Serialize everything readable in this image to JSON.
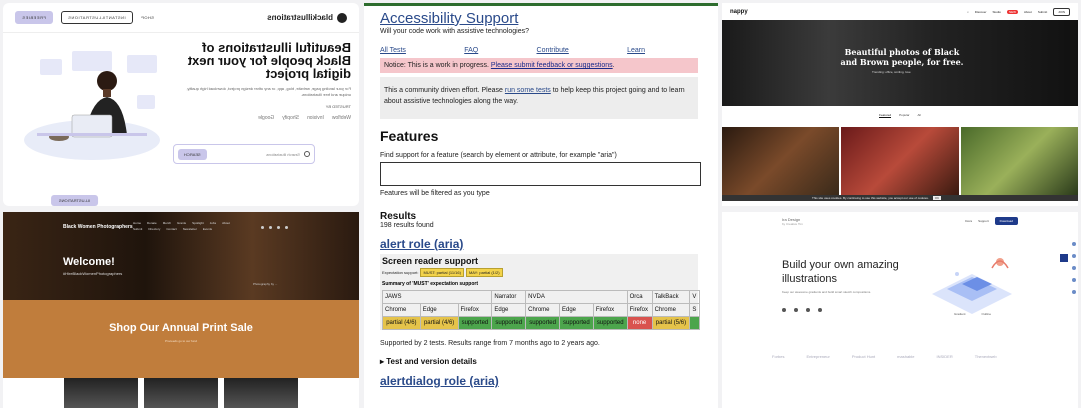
{
  "tile1": {
    "brand": "blackillustrations",
    "nav": [
      "FREEBIES",
      "INSTANTILLUSTRATIONS",
      "SHOP"
    ],
    "headline": "Beautiful illustrations of Black people for your next digital project",
    "body": "For your landing page, website, blog, app, or any other design project, download high quality, unique and free illustrations.",
    "trusted": "TRUSTED BY",
    "brands": [
      "Webflow",
      "Invision",
      "Shopify",
      "Google"
    ],
    "search_placeholder": "Search illustrations",
    "search_button": "SEARCH",
    "badge": "ILLUSTRATIONS",
    "accent": "#c9c6ea"
  },
  "tile2": {
    "brand": "Black Women Photographers",
    "menu": [
      "Home",
      "Donate",
      "Merch",
      "Grants",
      "Spotlight",
      "Jobs",
      "About",
      "Submit",
      "Directory",
      "Contact",
      "Newsletter",
      "Events"
    ],
    "headline": "Welcome!",
    "tagline": "#HireBlackWomenPhotographers",
    "credit": "Photography by ...",
    "sale_title": "Shop Our Annual Print Sale",
    "sale_sub": "Proceeds go to our fund",
    "sale_color": "#c07d3c"
  },
  "tile3": {
    "title": "Accessibility Support",
    "subtitle": "Will your code work with assistive technologies?",
    "nav": [
      "All Tests",
      "FAQ",
      "Contribute",
      "Learn"
    ],
    "notice_prefix": "Notice: This is a work in progress. ",
    "notice_link": "Please submit feedback or suggestions",
    "notice_suffix": ".",
    "community_pre": "This a community driven effort. Please ",
    "community_link": "run some tests",
    "community_post": " to help keep this project going and to learn about assistive technologies along the way.",
    "features_heading": "Features",
    "find_label": "Find support for a feature (search by element or attribute, for example \"aria\")",
    "filter_note": "Features will be filtered as you type",
    "results_heading": "Results",
    "results_count": "198 results found",
    "card_title": "alert role (aria)",
    "sr_heading": "Screen reader support",
    "expectation_label": "Expectation support:",
    "expectation_must": "MUST: partial (11/16)",
    "expectation_may": "MAY: partial (1/2)",
    "summary_label": "Summary of 'MUST' expectation support",
    "table": {
      "row1": [
        "JAWS",
        "",
        "Narrator",
        "NVDA",
        "",
        "Orca",
        "TalkBack",
        "V"
      ],
      "row2": [
        "Chrome",
        "Edge",
        "Firefox",
        "Edge",
        "Chrome",
        "Edge",
        "Firefox",
        "Firefox",
        "Chrome",
        "S"
      ],
      "row3": [
        "partial (4/6)",
        "partial (4/6)",
        "supported",
        "supported",
        "supported",
        "supported",
        "supported",
        "none",
        "partial (5/6)",
        ""
      ]
    },
    "supported_by": "Supported by 2 tests. Results range from 7 months ago to 2 years ago.",
    "test_details": "▸ Test and version details",
    "next_title": "alertdialog role (aria)"
  },
  "tile4": {
    "brand": "nappy",
    "links": [
      "Discover",
      "Studio",
      "About",
      "Submit"
    ],
    "new_badge": "NEW",
    "join": "JOIN",
    "headline": "Beautiful photos of Black and Brown people, for free.",
    "trending": "Trending: office, smiling, love",
    "tabs": [
      "Featured",
      "Popular",
      "All"
    ],
    "cookie": "This site uses cookies. By continuing to use this website, you accept our use of cookies.",
    "cookie_ok": "OK"
  },
  "tile5": {
    "logo": "Ira Design",
    "logo_sub": "by Creative Tim",
    "nav": [
      "Docs",
      "Support",
      "Download"
    ],
    "headline": "Build your own amazing illustrations",
    "desc": "Keep our awesome gradients and build smart sketch compositions.",
    "art_labels": [
      "Gradient",
      "Outline"
    ],
    "brand_logos": [
      "Forbes",
      "Entrepreneur",
      "Product Hunt",
      "mashable",
      "INSIDER",
      "Thenextweb"
    ]
  }
}
